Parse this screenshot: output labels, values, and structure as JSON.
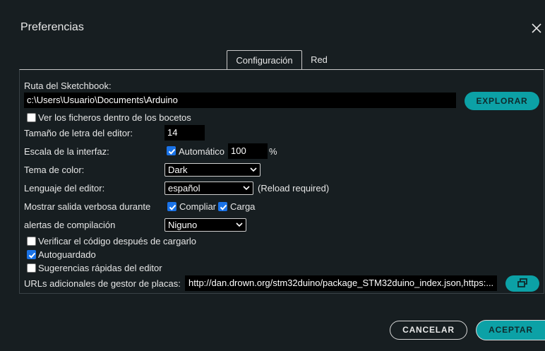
{
  "dialog": {
    "title": "Preferencias"
  },
  "tabs": [
    {
      "label": "Configuración",
      "active": true
    },
    {
      "label": "Red",
      "active": false
    }
  ],
  "sketchbook": {
    "label": "Ruta del Sketchbook:",
    "path": "c:\\Users\\Usuario\\Documents\\Arduino",
    "browse_label": "EXPLORAR",
    "show_files_label": "Ver los ficheros dentro de los bocetos",
    "show_files_checked": false
  },
  "font_size": {
    "label": "Tamaño de letra del editor:",
    "value": "14"
  },
  "scale": {
    "label": "Escala de la interfaz:",
    "auto_label": "Automático",
    "auto_checked": true,
    "value": "100",
    "unit": "%"
  },
  "theme": {
    "label": "Tema de color:",
    "value": "Dark"
  },
  "language": {
    "label": "Lenguaje del editor:",
    "value": "español",
    "note": "(Reload required)"
  },
  "verbose": {
    "label": "Mostrar salida verbosa durante",
    "compile_label": "Compliar",
    "compile_checked": true,
    "upload_label": "Carga",
    "upload_checked": true
  },
  "warnings": {
    "label": "alertas de compilación",
    "value": "Niguno"
  },
  "options": {
    "verify_label": "Verificar el código después de cargarlo",
    "verify_checked": false,
    "autosave_label": "Autoguardado",
    "autosave_checked": true,
    "quick_suggestions_label": "Sugerencias rápidas del editor",
    "quick_suggestions_checked": false
  },
  "board_urls": {
    "label": "URLs adicionales de gestor de placas:",
    "value": "http://dan.drown.org/stm32duino/package_STM32duino_index.json,https:..."
  },
  "footer": {
    "cancel_label": "CANCELAR",
    "accept_label": "ACEPTAR"
  },
  "colors": {
    "accent": "#0ca1a6",
    "background": "#171e21",
    "checkbox": "#1a73e8"
  },
  "icons": {
    "close": "close-icon",
    "open_window": "open-window-icon",
    "dropdown": "chevron-down-icon"
  }
}
